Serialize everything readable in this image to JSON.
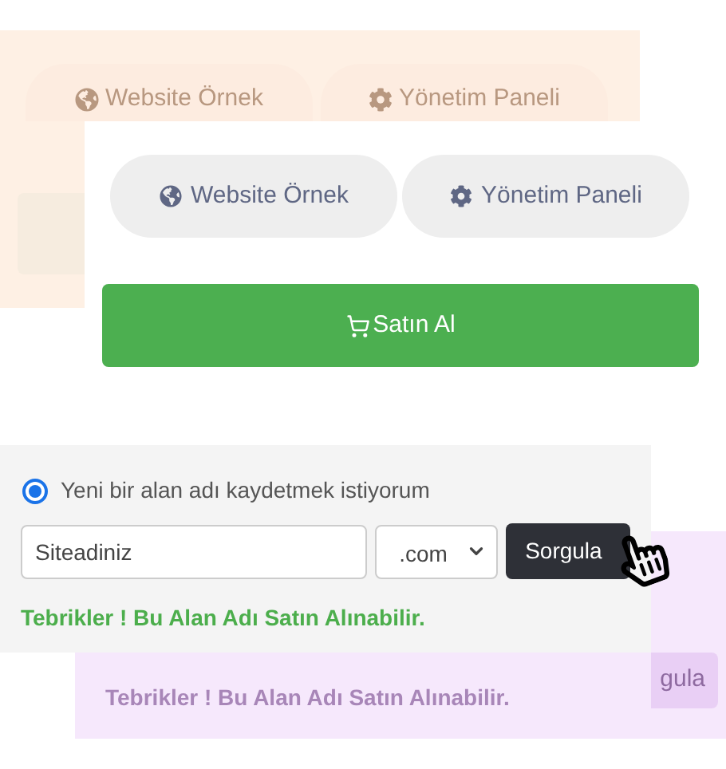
{
  "ghost_top": {
    "buttons": [
      {
        "label": "Website Örnek"
      },
      {
        "label": "Yönetim Paneli"
      }
    ]
  },
  "links": [
    {
      "label": "Website Örnek"
    },
    {
      "label": "Yönetim Paneli"
    }
  ],
  "buy_button": {
    "label": "Satın Al"
  },
  "domain_form": {
    "option": {
      "label": "Yeni bir alan adı kaydetmek istiyorum",
      "selected": true
    },
    "domain": {
      "value": "Siteadiniz"
    },
    "extension": {
      "value": ".com"
    },
    "query_button": {
      "label": "Sorgula"
    },
    "result": "Tebrikler ! Bu Alan Adı Satın Alınabilir."
  },
  "ghost_bottom": {
    "button_label": "gula",
    "result": "Tebrikler ! Bu Alan Adı Satın Alınabilir."
  }
}
